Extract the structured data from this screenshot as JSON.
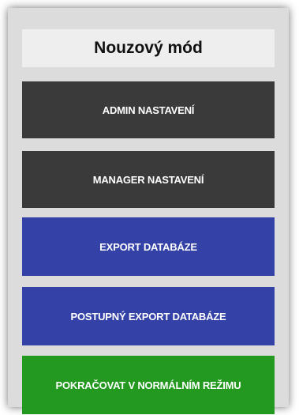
{
  "dialog": {
    "title": "Nouzový mód",
    "buttons": {
      "admin": "ADMIN NASTAVENÍ",
      "manager": "MANAGER NASTAVENÍ",
      "export": "EXPORT DATABÁZE",
      "postupny_export": "POSTUPNÝ EXPORT DATABÁZE",
      "continue": "POKRAČOVAT V NORMÁLNÍM REŽIMU"
    }
  },
  "colors": {
    "dialog_background": "#dcdcdc",
    "title_background": "#eeeeee",
    "dark_button": "#3a3a3a",
    "blue_button": "#3442a8",
    "green_button": "#239a1f"
  }
}
